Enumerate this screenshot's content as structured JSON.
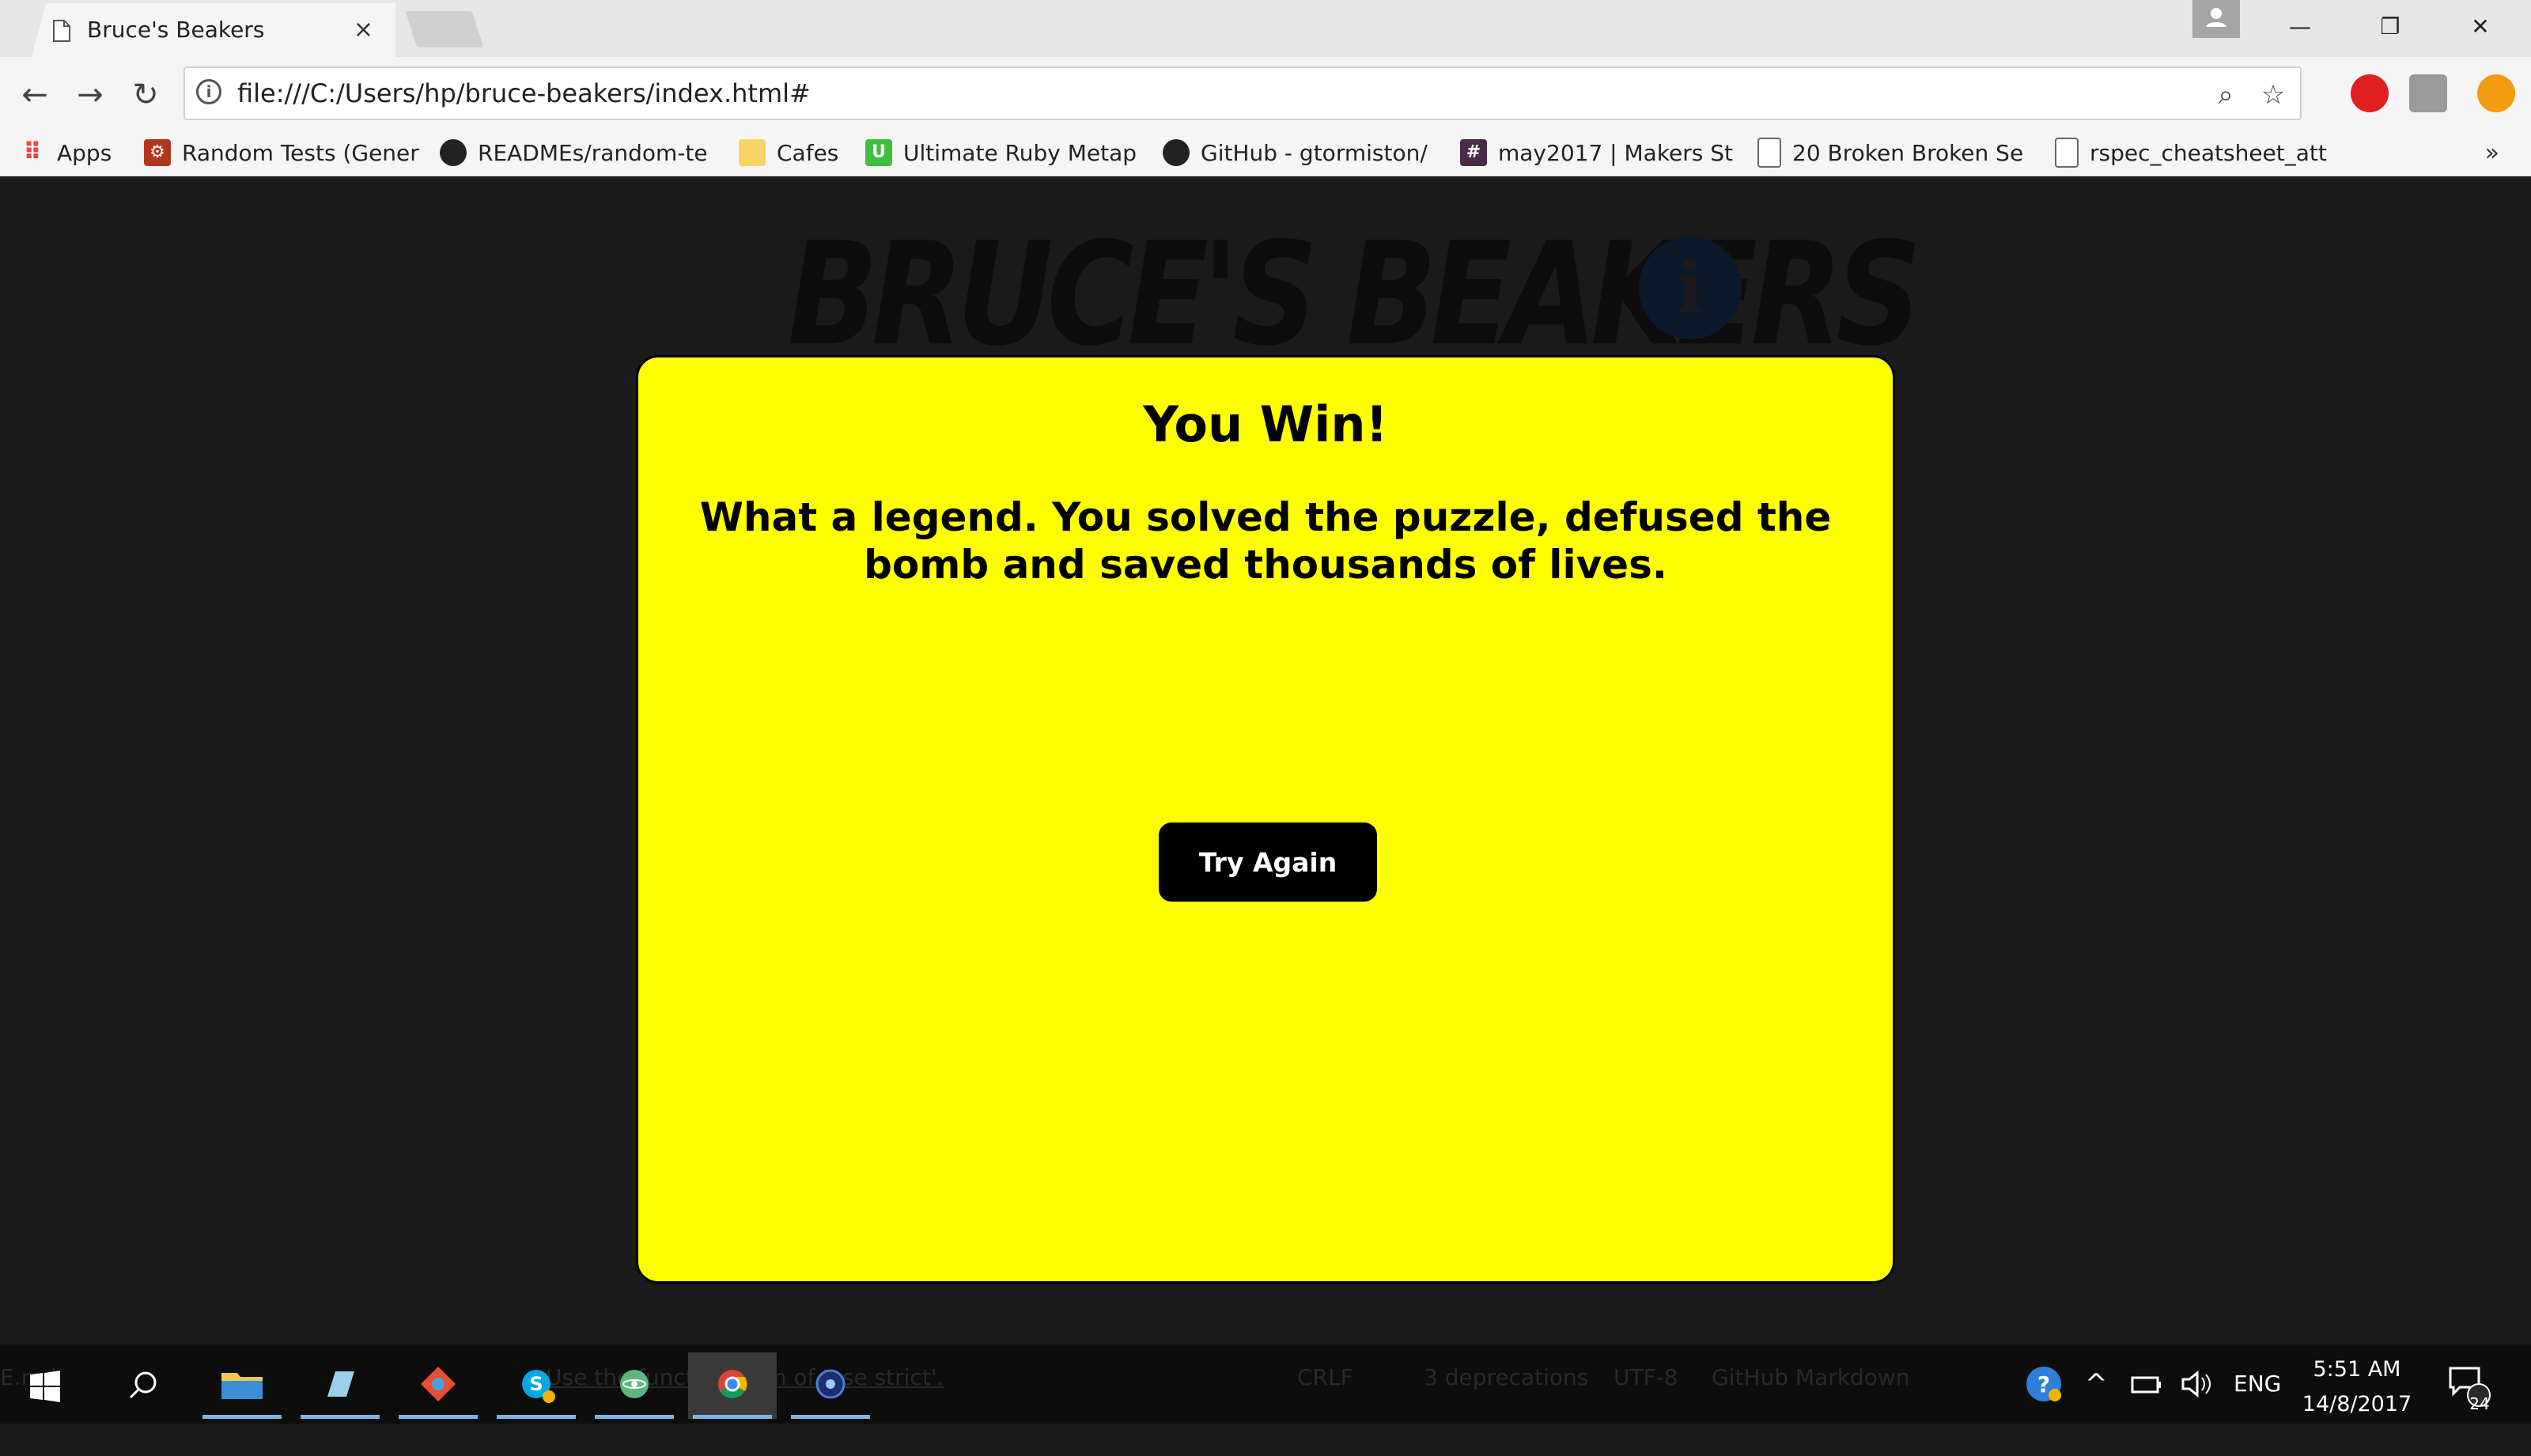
{
  "browser": {
    "tab_title": "Bruce's Beakers",
    "tab_close": "×",
    "url": "file:///C:/Users/hp/bruce-beakers/index.html#",
    "window_controls": {
      "minimize": "—",
      "restore": "❐",
      "close": "✕"
    },
    "bookmarks": [
      {
        "label": "Apps",
        "icon": "apps-grid-icon"
      },
      {
        "label": "Random Tests (Gener",
        "icon": "codewars-icon"
      },
      {
        "label": "READMEs/random-te",
        "icon": "github-icon"
      },
      {
        "label": "Cafes",
        "icon": "folder-icon"
      },
      {
        "label": "Ultimate Ruby Metap",
        "icon": "udemy-icon"
      },
      {
        "label": "GitHub - gtormiston/",
        "icon": "github-icon"
      },
      {
        "label": "may2017 | Makers St",
        "icon": "slack-hash-icon"
      },
      {
        "label": "20 Broken Broken Se",
        "icon": "page-icon"
      },
      {
        "label": "rspec_cheatsheet_att",
        "icon": "page-icon"
      }
    ],
    "bookmarks_more": "»"
  },
  "page": {
    "logo_text": "BRUCE'S BEAKERS",
    "logo_info_glyph": "i",
    "modal": {
      "title": "You Win!",
      "message": "What a legend. You solved the puzzle, defused the bomb and saved thousands of lives.",
      "button_label": "Try Again",
      "background": "#ffff00"
    }
  },
  "taskbar": {
    "ghost_text_left": "E.md",
    "ghost_text_mid": "Use the function form of 'use strict'.",
    "ghost_items": [
      "CRLF",
      "3 deprecations",
      "UTF-8",
      "GitHub Markdown"
    ],
    "tray_language": "ENG",
    "clock_time": "5:51 AM",
    "clock_date": "14/8/2017",
    "notification_count": "24"
  }
}
